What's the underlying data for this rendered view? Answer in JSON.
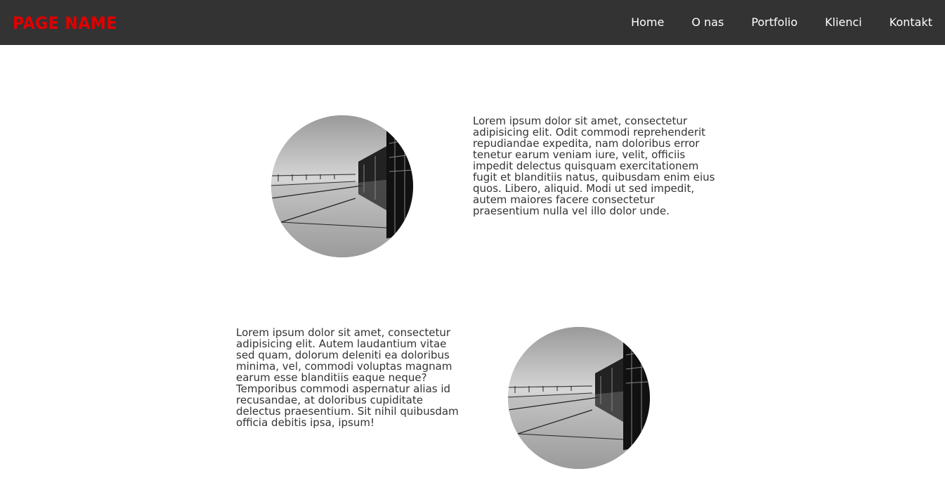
{
  "header": {
    "logo": "PAGE NAME",
    "logo_color": "#e00000",
    "background": "#333333",
    "nav": [
      "Home",
      "O nas",
      "Portfolio",
      "Klienci",
      "Kontakt"
    ]
  },
  "sections": [
    {
      "text": "Lorem ipsum dolor sit amet, consectetur adipisicing elit. Odit commodi reprehenderit repudiandae expedita, nam doloribus error tenetur earum veniam iure, velit, officiis impedit delectus quisquam exercitationem fugit et blanditiis natus, quibusdam enim eius quos. Libero, aliquid. Modi ut sed impedit, autem maiores facere consectetur praesentium nulla vel illo dolor unde."
    },
    {
      "text": "Lorem ipsum dolor sit amet, consectetur adipisicing elit. Autem laudantium vitae sed quam, dolorum deleniti ea doloribus minima, vel, commodi voluptas magnam earum esse blanditiis eaque neque? Temporibus commodi aspernatur alias id recusandae, at doloribus cupiditate delectus praesentium. Sit nihil quibusdam officia debitis ipsa, ipsum!"
    }
  ]
}
